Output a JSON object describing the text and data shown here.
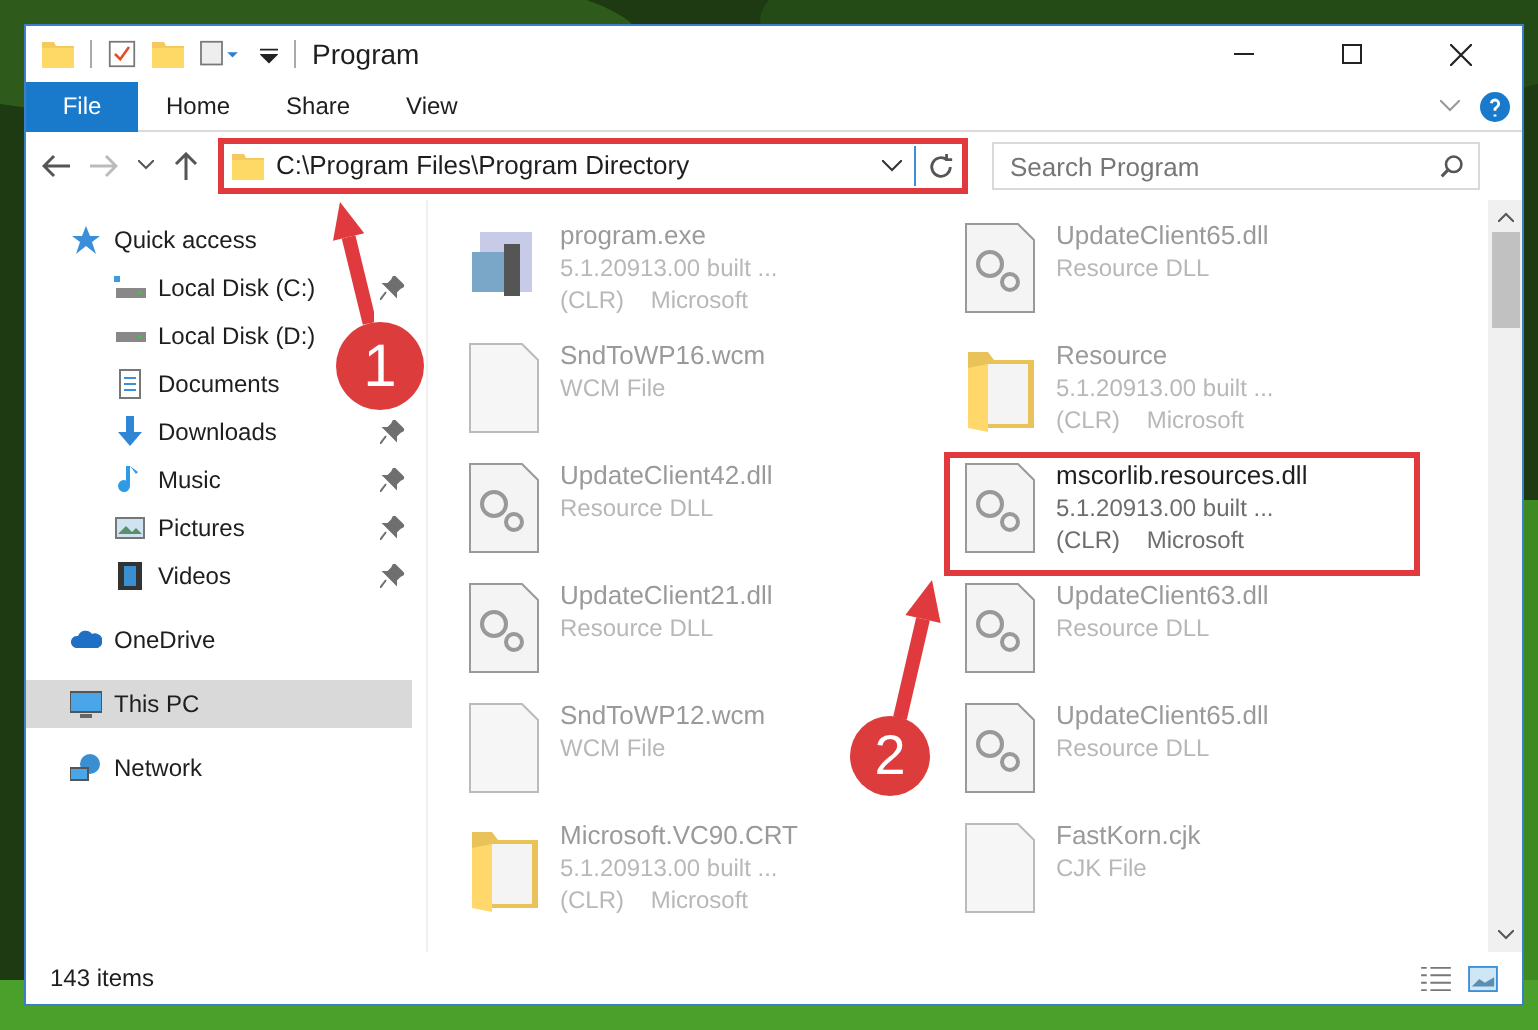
{
  "window": {
    "title": "Program"
  },
  "ribbon": {
    "tabs": [
      {
        "label": "File",
        "selected": true
      },
      {
        "label": "Home",
        "selected": false
      },
      {
        "label": "Share",
        "selected": false
      },
      {
        "label": "View",
        "selected": false
      }
    ]
  },
  "address": {
    "path": "C:\\Program Files\\Program Directory",
    "highlighted": true
  },
  "search": {
    "placeholder": "Search Program"
  },
  "nav": [
    {
      "label": "Quick access",
      "kind": "star",
      "selected": false,
      "children": [
        {
          "label": "Local Disk (C:)",
          "kind": "system-disk",
          "pinned": true,
          "selected": false
        },
        {
          "label": "Local Disk (D:)",
          "kind": "disk",
          "pinned": false,
          "selected": false
        },
        {
          "label": "Documents",
          "kind": "documents",
          "pinned": false,
          "selected": false
        },
        {
          "label": "Downloads",
          "kind": "downloads",
          "pinned": true,
          "selected": false
        },
        {
          "label": "Music",
          "kind": "music",
          "pinned": true,
          "selected": false
        },
        {
          "label": "Pictures",
          "kind": "pictures",
          "pinned": true,
          "selected": false
        },
        {
          "label": "Videos",
          "kind": "videos",
          "pinned": true,
          "selected": false
        }
      ]
    },
    {
      "label": "OneDrive",
      "kind": "cloud",
      "selected": false
    },
    {
      "label": "This PC",
      "kind": "computer",
      "selected": true
    },
    {
      "label": "Network",
      "kind": "network",
      "selected": false
    }
  ],
  "files": [
    {
      "name": "program.exe",
      "details": [
        "5.1.20913.00 built ...",
        "(CLR)    Microsoft"
      ],
      "kind": "exe",
      "highlighted": false
    },
    {
      "name": "UpdateClient65.dll",
      "details": [
        "Resource DLL"
      ],
      "kind": "dll",
      "highlighted": false
    },
    {
      "name": "SndToWP16.wcm",
      "details": [
        "WCM File"
      ],
      "kind": "file",
      "highlighted": false
    },
    {
      "name": "Resource",
      "details": [
        "5.1.20913.00 built ...",
        "(CLR)    Microsoft"
      ],
      "kind": "folder",
      "highlighted": false
    },
    {
      "name": "UpdateClient42.dll",
      "details": [
        "Resource DLL"
      ],
      "kind": "dll",
      "highlighted": false
    },
    {
      "name": "mscorlib.resources.dll",
      "details": [
        "5.1.20913.00 built ...",
        "(CLR)    Microsoft"
      ],
      "kind": "dll",
      "highlighted": true
    },
    {
      "name": "UpdateClient21.dll",
      "details": [
        "Resource DLL"
      ],
      "kind": "dll",
      "highlighted": false
    },
    {
      "name": "UpdateClient63.dll",
      "details": [
        "Resource DLL"
      ],
      "kind": "dll",
      "highlighted": false
    },
    {
      "name": "SndToWP12.wcm",
      "details": [
        "WCM File"
      ],
      "kind": "file",
      "highlighted": false
    },
    {
      "name": "UpdateClient65.dll",
      "details": [
        "Resource DLL"
      ],
      "kind": "dll",
      "highlighted": false
    },
    {
      "name": "Microsoft.VC90.CRT",
      "details": [
        "5.1.20913.00 built ...",
        "(CLR)    Microsoft"
      ],
      "kind": "folder",
      "highlighted": false
    },
    {
      "name": "FastKorn.cjk",
      "details": [
        "CJK File"
      ],
      "kind": "file",
      "highlighted": false
    }
  ],
  "status_bar": {
    "count": "143 items"
  },
  "callouts": [
    {
      "number": "1"
    },
    {
      "number": "2"
    }
  ]
}
